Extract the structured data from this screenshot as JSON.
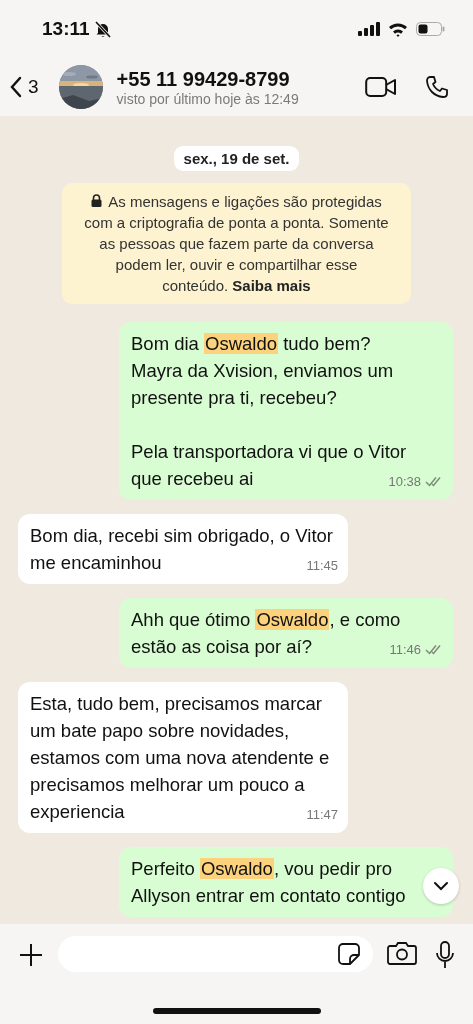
{
  "status_bar": {
    "time": "13:11",
    "silenced": true
  },
  "header": {
    "back_count": "3",
    "contact": "+55 11 99429-8799",
    "last_seen": "visto por último hoje às 12:49"
  },
  "date_chip": "sex., 19 de set.",
  "encryption_notice": {
    "text": "As mensagens e ligações são protegidas com a criptografia de ponta a ponta. Somente as pessoas que fazem parte da conversa podem ler, ouvir e compartilhar esse conteúdo.",
    "link": "Saiba mais"
  },
  "messages": [
    {
      "kind": "outgoing",
      "parts": [
        {
          "text": "Bom dia ",
          "highlighted": false
        },
        {
          "text": "Oswaldo",
          "highlighted": true
        },
        {
          "text": " tudo bem?\nMayra da Xvision, enviamos um presente pra ti, recebeu?\n\nPela transportadora vi que o Vitor que recebeu ai",
          "highlighted": false
        }
      ],
      "time": "10:38",
      "delivered": true
    },
    {
      "kind": "incoming",
      "parts": [
        {
          "text": "Bom dia, recebi sim obrigado, o Vitor me encaminhou",
          "highlighted": false
        }
      ],
      "time": "11:45"
    },
    {
      "kind": "outgoing",
      "parts": [
        {
          "text": "Ahh que ótimo ",
          "highlighted": false
        },
        {
          "text": "Oswaldo",
          "highlighted": true
        },
        {
          "text": ", e como estão as coisa por aí?",
          "highlighted": false
        }
      ],
      "time": "11:46",
      "delivered": true
    },
    {
      "kind": "incoming",
      "parts": [
        {
          "text": "Esta, tudo bem, precisamos marcar um bate papo sobre novidades, estamos com uma nova atendente e precisamos melhorar um pouco a experiencia",
          "highlighted": false
        }
      ],
      "time": "11:47"
    },
    {
      "kind": "outgoing",
      "parts": [
        {
          "text": "Perfeito ",
          "highlighted": false
        },
        {
          "text": "Oswaldo",
          "highlighted": true
        },
        {
          "text": ", vou pedir pro Allyson entrar em contato contigo",
          "highlighted": false
        }
      ]
    }
  ]
}
